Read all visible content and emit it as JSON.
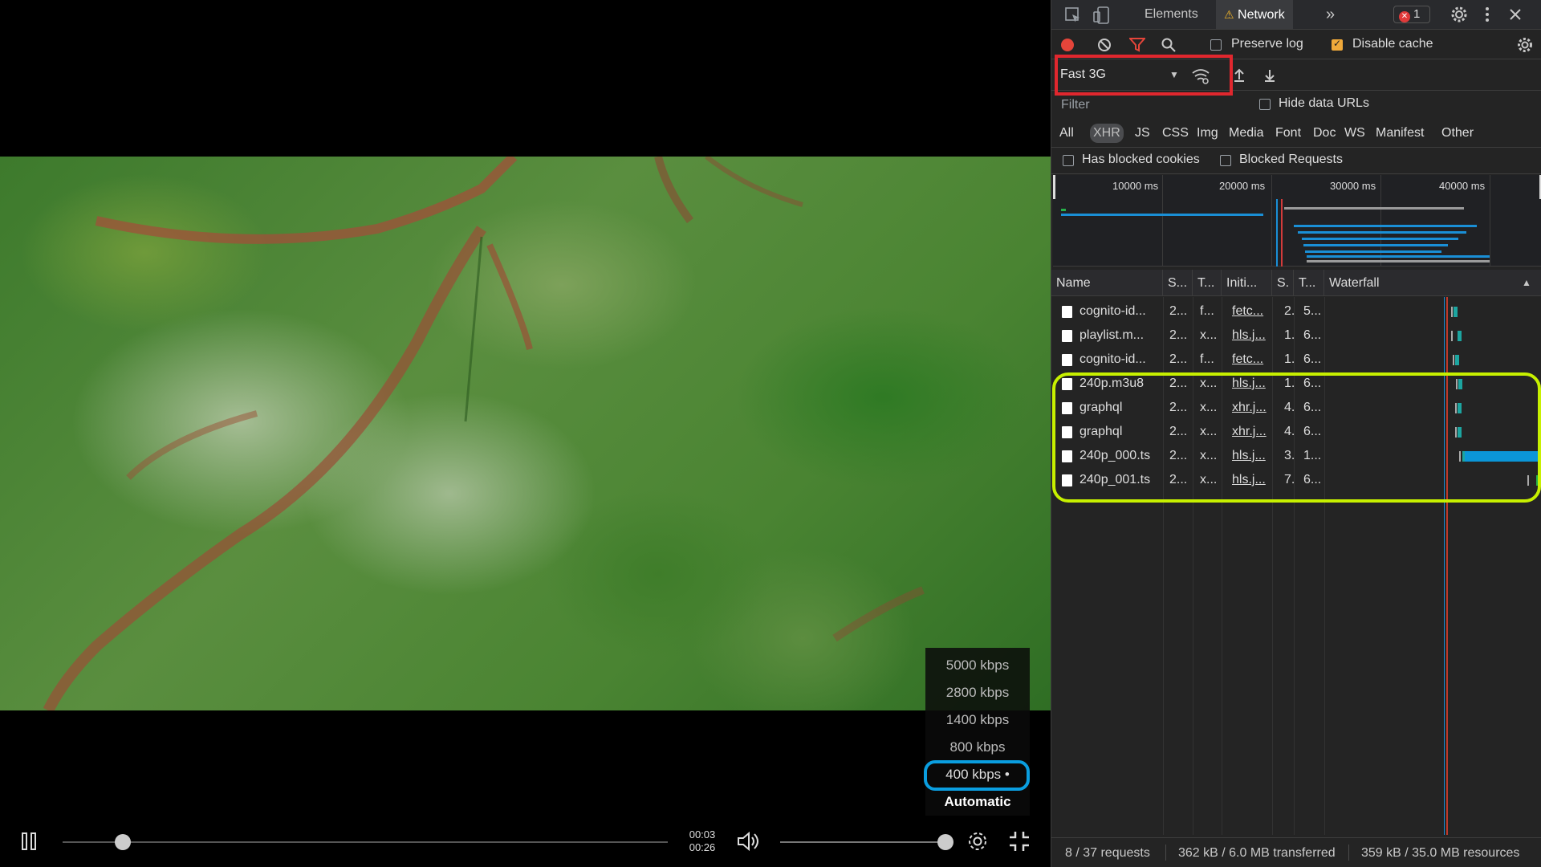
{
  "player": {
    "time_current": "00:03",
    "time_total": "00:26",
    "seek_progress": 0.1,
    "volume_level": 1.0,
    "quality_options": [
      "5000 kbps",
      "2800 kbps",
      "1400 kbps",
      "800 kbps",
      "400 kbps •",
      "Automatic"
    ],
    "quality_selected": "400 kbps •"
  },
  "devtools": {
    "tabs": {
      "elements": "Elements",
      "network": "Network"
    },
    "error_count": "1",
    "preserve_log": "Preserve log",
    "disable_cache": "Disable cache",
    "throttle": "Fast 3G",
    "filter_placeholder": "Filter",
    "hide_data_urls": "Hide data URLs",
    "types": [
      "All",
      "XHR",
      "JS",
      "CSS",
      "Img",
      "Media",
      "Font",
      "Doc",
      "WS",
      "Manifest",
      "Other"
    ],
    "active_type": "XHR",
    "has_blocked_cookies": "Has blocked cookies",
    "blocked_requests": "Blocked Requests",
    "overview_ticks": [
      "10000 ms",
      "20000 ms",
      "30000 ms",
      "40000 ms"
    ],
    "columns": [
      "Name",
      "S...",
      "T...",
      "Initi...",
      "S.",
      "T...",
      "Waterfall"
    ],
    "rows": [
      {
        "name": "cognito-id...",
        "status": "2...",
        "type": "f...",
        "initiator": "fetc...",
        "size": "2..",
        "time": "5..."
      },
      {
        "name": "playlist.m...",
        "status": "2...",
        "type": "x...",
        "initiator": "hls.j...",
        "size": "1..",
        "time": "6..."
      },
      {
        "name": "cognito-id...",
        "status": "2...",
        "type": "f...",
        "initiator": "fetc...",
        "size": "1..",
        "time": "6..."
      },
      {
        "name": "240p.m3u8",
        "status": "2...",
        "type": "x...",
        "initiator": "hls.j...",
        "size": "1..",
        "time": "6..."
      },
      {
        "name": "graphql",
        "status": "2...",
        "type": "x...",
        "initiator": "xhr.j...",
        "size": "4..",
        "time": "6..."
      },
      {
        "name": "graphql",
        "status": "2...",
        "type": "x...",
        "initiator": "xhr.j...",
        "size": "4..",
        "time": "6..."
      },
      {
        "name": "240p_000.ts",
        "status": "2...",
        "type": "x...",
        "initiator": "hls.j...",
        "size": "3..",
        "time": "1..."
      },
      {
        "name": "240p_001.ts",
        "status": "2...",
        "type": "x...",
        "initiator": "hls.j...",
        "size": "7..",
        "time": "6..."
      }
    ],
    "status": {
      "requests": "8 / 37 requests",
      "transferred": "362 kB / 6.0 MB transferred",
      "resources": "359 kB / 35.0 MB resources"
    }
  }
}
